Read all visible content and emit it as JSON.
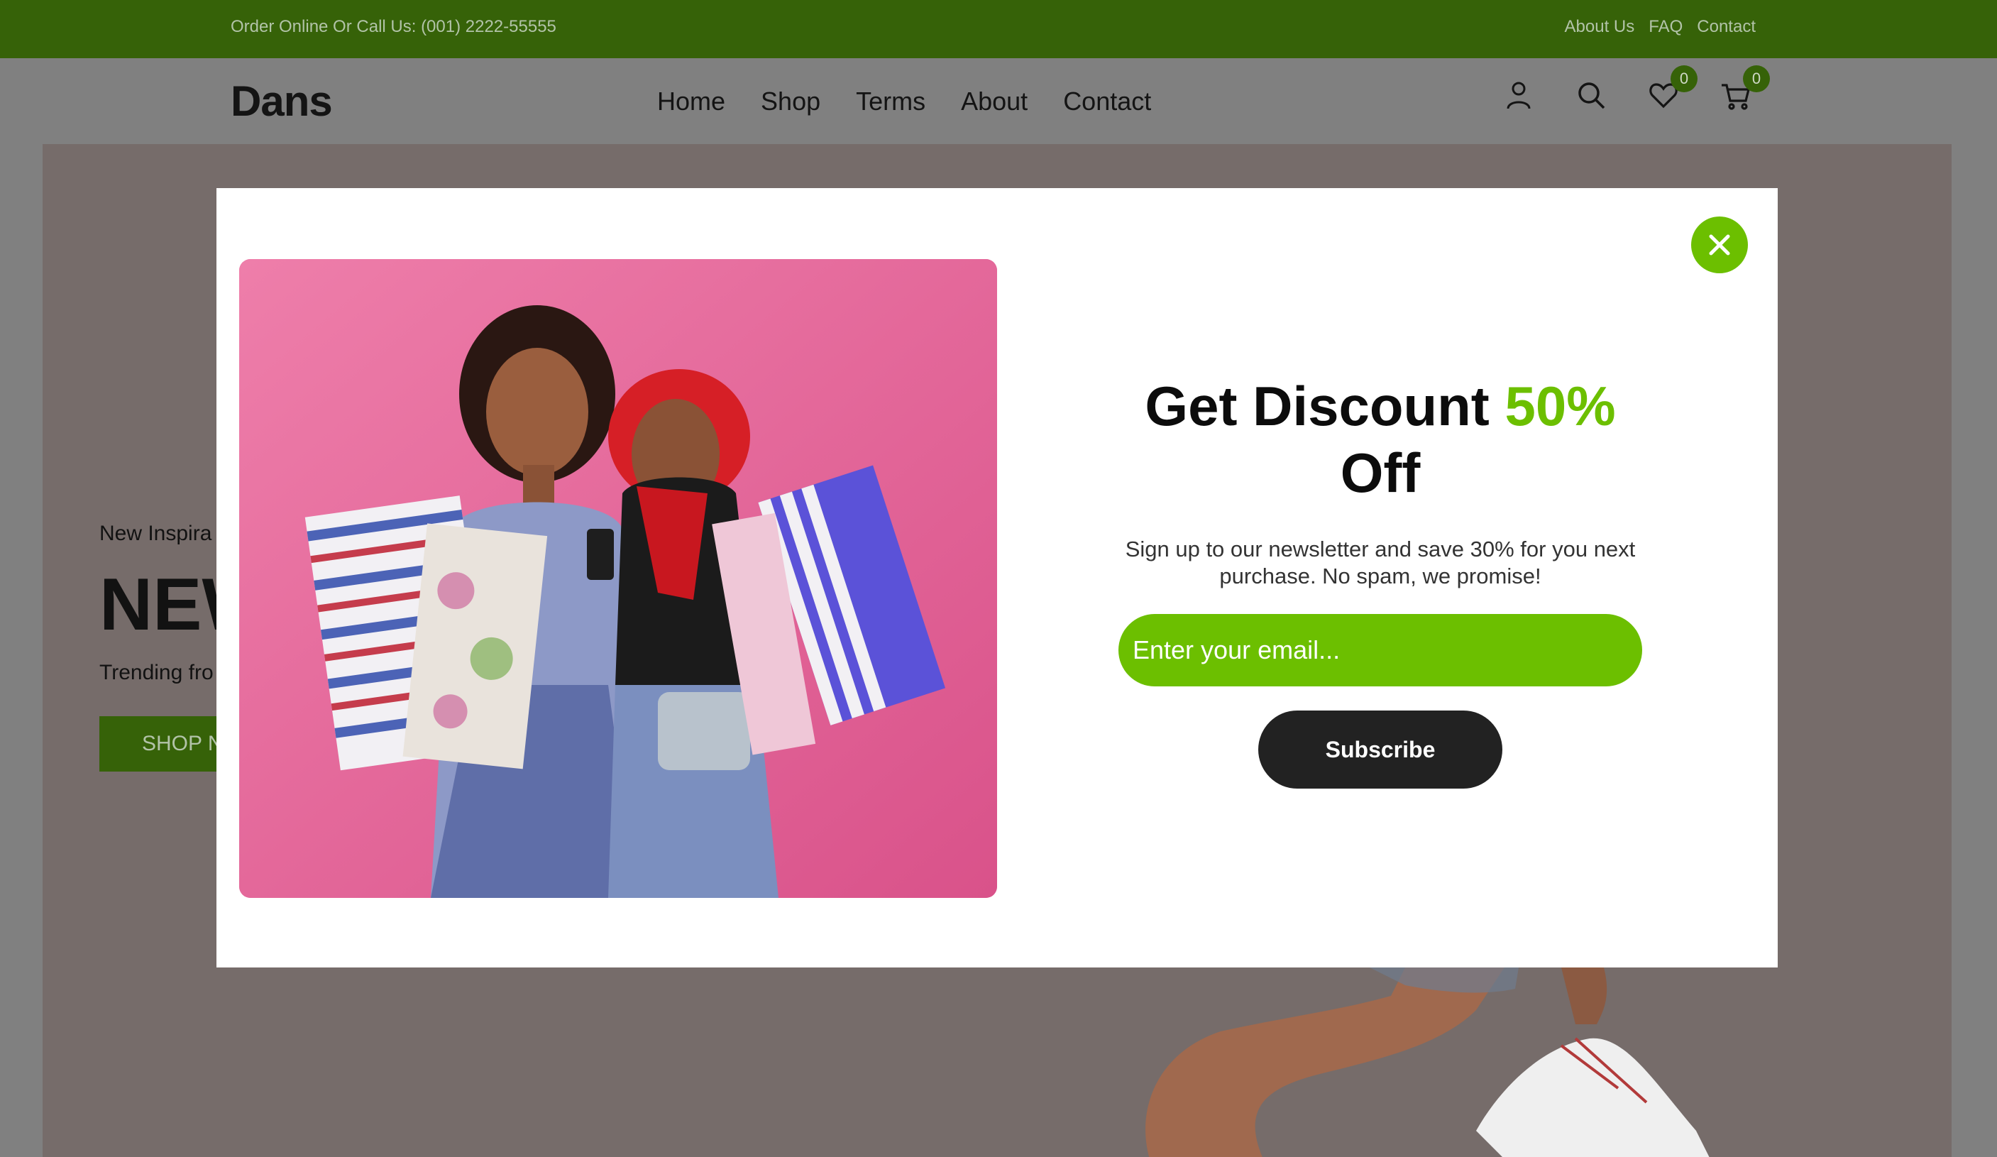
{
  "topbar": {
    "phone": "Order Online Or Call Us: (001) 2222-55555",
    "links": [
      "About Us",
      "FAQ",
      "Contact"
    ]
  },
  "header": {
    "logo": "Dans",
    "nav": [
      "Home",
      "Shop",
      "Terms",
      "About",
      "Contact"
    ],
    "wishlist_count": "0",
    "cart_count": "0",
    "icons": [
      "user-icon",
      "search-icon",
      "heart-icon",
      "cart-icon"
    ]
  },
  "hero": {
    "subtitle_visible": "New Inspira",
    "headline_visible": "NEW",
    "trend_visible": "Trending fro",
    "button_visible": "SHOP N"
  },
  "modal": {
    "title_main": "Get Discount",
    "title_accent": "50%",
    "title_end": "Off",
    "description": "Sign up to our newsletter and save 30% for you next purchase. No spam, we promise!",
    "email_placeholder": "Enter your email...",
    "subscribe_label": "Subscribe",
    "image_alt": "two-women-holding-shopping-bags-photo"
  },
  "colors": {
    "topbar": "#366208",
    "accent": "#6cbf00",
    "subscribe_bg": "#222222",
    "overlay_page": "#808080",
    "photo_bg": "#e4729e"
  }
}
